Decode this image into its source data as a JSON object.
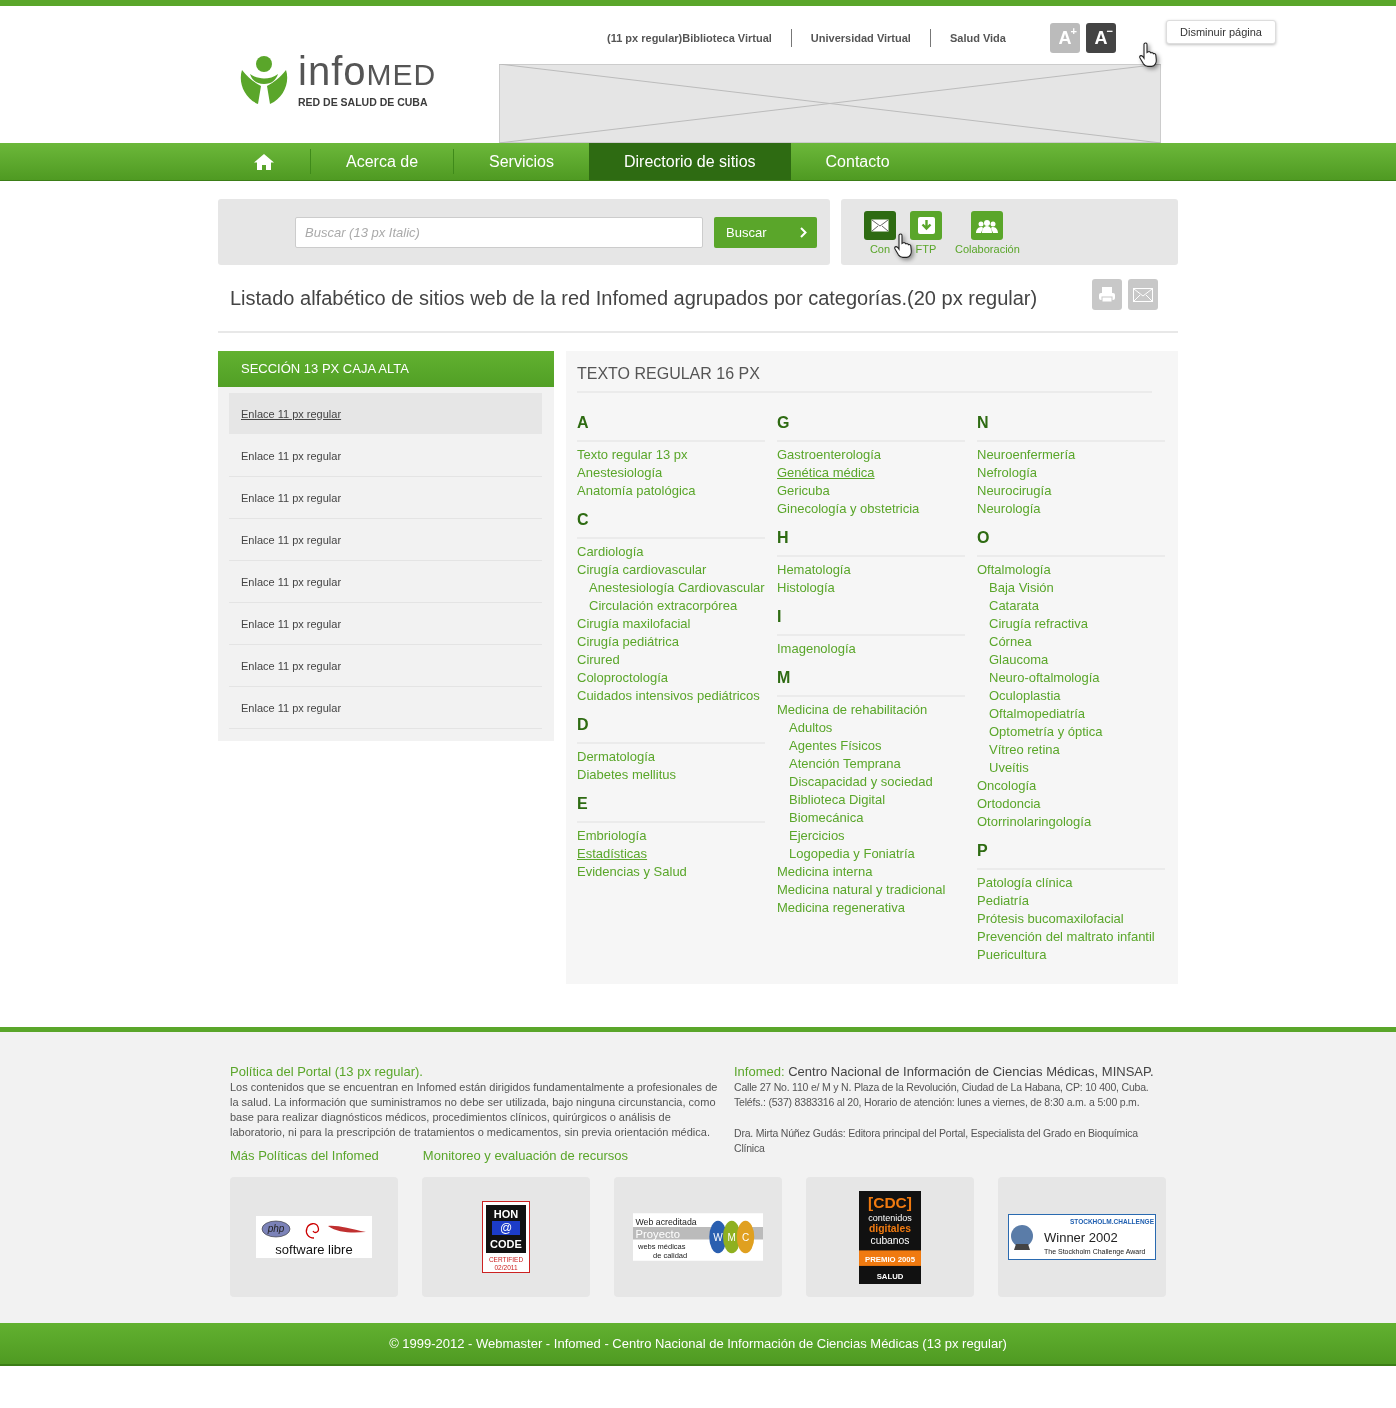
{
  "header": {
    "top_links": [
      "(11 px regular)Biblioteca Virtual",
      "Universidad Virtual",
      "Salud Vida"
    ],
    "font_buttons": [
      {
        "letter": "A",
        "sign": "+",
        "selected": false
      },
      {
        "letter": "A",
        "sign": "−",
        "selected": true
      }
    ],
    "tooltip": "Disminuir página",
    "logo": {
      "wordmark": [
        "info",
        "MED"
      ],
      "tagline": "RED DE SALUD DE CUBA"
    }
  },
  "nav": [
    {
      "kind": "home",
      "selected": false
    },
    {
      "kind": "link",
      "label": "Acerca de",
      "selected": false
    },
    {
      "kind": "link",
      "label": "Servicios",
      "selected": false
    },
    {
      "kind": "link",
      "label": "Directorio de sitios",
      "selected": true
    },
    {
      "kind": "link",
      "label": "Contacto",
      "selected": false
    }
  ],
  "search": {
    "placeholder": "Buscar (13 px Italic)",
    "button": "Buscar"
  },
  "tools": [
    {
      "kind": "mail",
      "label": "Con",
      "selected": true
    },
    {
      "kind": "download",
      "label": "FTP",
      "selected": false
    },
    {
      "kind": "group",
      "label": "Colaboración",
      "selected": false
    }
  ],
  "page_title": "Listado alfabético de sitios web de la red Infomed agrupados por categorías.(20 px regular)",
  "sidebar": {
    "title": "SECCIÓN 13 PX CAJA ALTA",
    "items": [
      {
        "label": "Enlace 11 px regular",
        "selected": true
      },
      {
        "label": "Enlace 11 px regular",
        "selected": false
      },
      {
        "label": "Enlace 11 px regular",
        "selected": false
      },
      {
        "label": "Enlace 11 px regular",
        "selected": false
      },
      {
        "label": "Enlace 11 px regular",
        "selected": false
      },
      {
        "label": "Enlace 11 px regular",
        "selected": false
      },
      {
        "label": "Enlace 11 px regular",
        "selected": false
      },
      {
        "label": "Enlace 11 px regular",
        "selected": false
      }
    ]
  },
  "directory": {
    "title": "TEXTO REGULAR 16 PX",
    "columns": [
      [
        {
          "letter": "A",
          "items": [
            {
              "label": "Texto regular 13 px",
              "underlined": false
            },
            {
              "label": "Anestesiología",
              "underlined": false
            },
            {
              "label": "Anatomía patológica",
              "underlined": false
            }
          ]
        },
        {
          "letter": "C",
          "items": [
            {
              "label": "Cardiología",
              "underlined": false
            },
            {
              "label": "Cirugía cardiovascular",
              "underlined": false,
              "children": [
                {
                  "label": "Anestesiología Cardiovascular",
                  "underlined": false
                },
                {
                  "label": "Circulación extracorpórea",
                  "underlined": false
                }
              ]
            },
            {
              "label": "Cirugía maxilofacial",
              "underlined": false
            },
            {
              "label": "Cirugía pediátrica",
              "underlined": false
            },
            {
              "label": "Cirured",
              "underlined": false
            },
            {
              "label": "Coloproctología",
              "underlined": false
            },
            {
              "label": "Cuidados intensivos pediátricos",
              "underlined": false
            }
          ]
        },
        {
          "letter": "D",
          "items": [
            {
              "label": "Dermatología",
              "underlined": false
            },
            {
              "label": "Diabetes mellitus",
              "underlined": false
            }
          ]
        },
        {
          "letter": "E",
          "items": [
            {
              "label": "Embriología",
              "underlined": false
            },
            {
              "label": "Estadísticas",
              "underlined": true
            },
            {
              "label": "Evidencias y Salud",
              "underlined": false
            }
          ]
        }
      ],
      [
        {
          "letter": "G",
          "items": [
            {
              "label": "Gastroenterología",
              "underlined": false
            },
            {
              "label": "Genética médica",
              "underlined": true
            },
            {
              "label": "Gericuba",
              "underlined": false
            },
            {
              "label": "Ginecología y obstetricia",
              "underlined": false
            }
          ]
        },
        {
          "letter": "H",
          "items": [
            {
              "label": "Hematología",
              "underlined": false
            },
            {
              "label": "Histología",
              "underlined": false
            }
          ]
        },
        {
          "letter": "I",
          "items": [
            {
              "label": "Imagenología",
              "underlined": false
            }
          ]
        },
        {
          "letter": "M",
          "items": [
            {
              "label": "Medicina de rehabilitación",
              "underlined": false,
              "children": [
                {
                  "label": "Adultos",
                  "underlined": false
                },
                {
                  "label": "Agentes Físicos",
                  "underlined": false
                },
                {
                  "label": "Atención Temprana",
                  "underlined": false
                },
                {
                  "label": "Discapacidad y sociedad",
                  "underlined": false
                },
                {
                  "label": "Biblioteca Digital",
                  "underlined": false
                },
                {
                  "label": "Biomecánica",
                  "underlined": false
                },
                {
                  "label": "Ejercicios",
                  "underlined": false
                },
                {
                  "label": "Logopedia y Foniatría",
                  "underlined": false
                }
              ]
            },
            {
              "label": "Medicina interna",
              "underlined": false
            },
            {
              "label": "Medicina natural y tradicional",
              "underlined": false
            },
            {
              "label": "Medicina regenerativa",
              "underlined": false
            }
          ]
        }
      ],
      [
        {
          "letter": "N",
          "items": [
            {
              "label": "Neuroenfermería",
              "underlined": false
            },
            {
              "label": "Nefrología",
              "underlined": false
            },
            {
              "label": "Neurocirugía",
              "underlined": false
            },
            {
              "label": "Neurología",
              "underlined": false
            }
          ]
        },
        {
          "letter": "O",
          "items": [
            {
              "label": "Oftalmología",
              "underlined": false,
              "children": [
                {
                  "label": "Baja Visión",
                  "underlined": false
                },
                {
                  "label": "Catarata",
                  "underlined": false
                },
                {
                  "label": "Cirugía refractiva",
                  "underlined": false
                },
                {
                  "label": "Córnea",
                  "underlined": false
                },
                {
                  "label": "Glaucoma",
                  "underlined": false
                },
                {
                  "label": "Neuro-oftalmología",
                  "underlined": false
                },
                {
                  "label": "Oculoplastia",
                  "underlined": false
                },
                {
                  "label": "Oftalmopediatría",
                  "underlined": false
                },
                {
                  "label": "Optometría y óptica",
                  "underlined": false
                },
                {
                  "label": "Vítreo retina",
                  "underlined": false
                },
                {
                  "label": "Uveítis",
                  "underlined": false
                }
              ]
            },
            {
              "label": "Oncología",
              "underlined": false
            },
            {
              "label": "Ortodoncia",
              "underlined": false
            },
            {
              "label": "Otorrinolaringología",
              "underlined": false
            }
          ]
        },
        {
          "letter": "P",
          "items": [
            {
              "label": "Patología clínica",
              "underlined": false
            },
            {
              "label": "Pediatría",
              "underlined": false
            },
            {
              "label": "Prótesis bucomaxilofacial",
              "underlined": false
            },
            {
              "label": "Prevención del maltrato infantil",
              "underlined": false
            },
            {
              "label": "Puericultura",
              "underlined": false
            }
          ]
        }
      ]
    ]
  },
  "footer": {
    "policy_title": "Política del Portal (13 px regular).",
    "policy_text": "Los contenidos que se encuentran en Infomed están dirigidos fundamentalmente a profesionales de la salud. La información que suministramos no debe ser utilizada, bajo ninguna circunstancia, como base para realizar diagnósticos médicos, procedimientos clínicos, quirúrgicos o análisis de laboratorio, ni para la prescripción de tratamientos o medicamentos, sin previa orientación médica.",
    "links": [
      "Más Políticas del Infomed",
      "Monitoreo y evaluación de recursos"
    ],
    "org_label": "Infomed:",
    "org_name": "Centro Nacional de Información de Ciencias Médicas, MINSAP.",
    "address": "Calle 27 No. 110 e/ M y N. Plaza de la Revolución, Ciudad de La Habana, CP: 10 400, Cuba.",
    "phones": "Teléfs.: (537) 8383316 al 20, Horario de atención: lunes a viernes, de 8:30 a.m. a 5:00 p.m.",
    "editor": "Dra. Mirta Núñez Gudás: Editora principal del Portal, Especialista del Grado en Bioquímica Clínica",
    "badges": [
      {
        "kind": "software-libre",
        "texts": [
          "php",
          "software libre"
        ]
      },
      {
        "kind": "hon",
        "texts": [
          "HON",
          "@",
          "CODE",
          "CERTIFIED",
          "02/2011"
        ]
      },
      {
        "kind": "wmc",
        "texts": [
          "Web acreditada",
          "Proyecto",
          "webs médicas",
          "de calidad",
          "W",
          "M",
          "C"
        ]
      },
      {
        "kind": "cdc",
        "texts": [
          "[CDC]",
          "contenidos",
          "digitales",
          "cubanos",
          "PREMIO 2005",
          "SALUD"
        ]
      },
      {
        "kind": "stockholm",
        "texts": [
          "STOCKHOLM.CHALLENGE",
          "Winner 2002",
          "The Stockholm Challenge Award"
        ]
      }
    ],
    "copyright": "© 1999-2012 - Webmaster - Infomed - Centro Nacional de Información de Ciencias Médicas (13 px regular)"
  }
}
